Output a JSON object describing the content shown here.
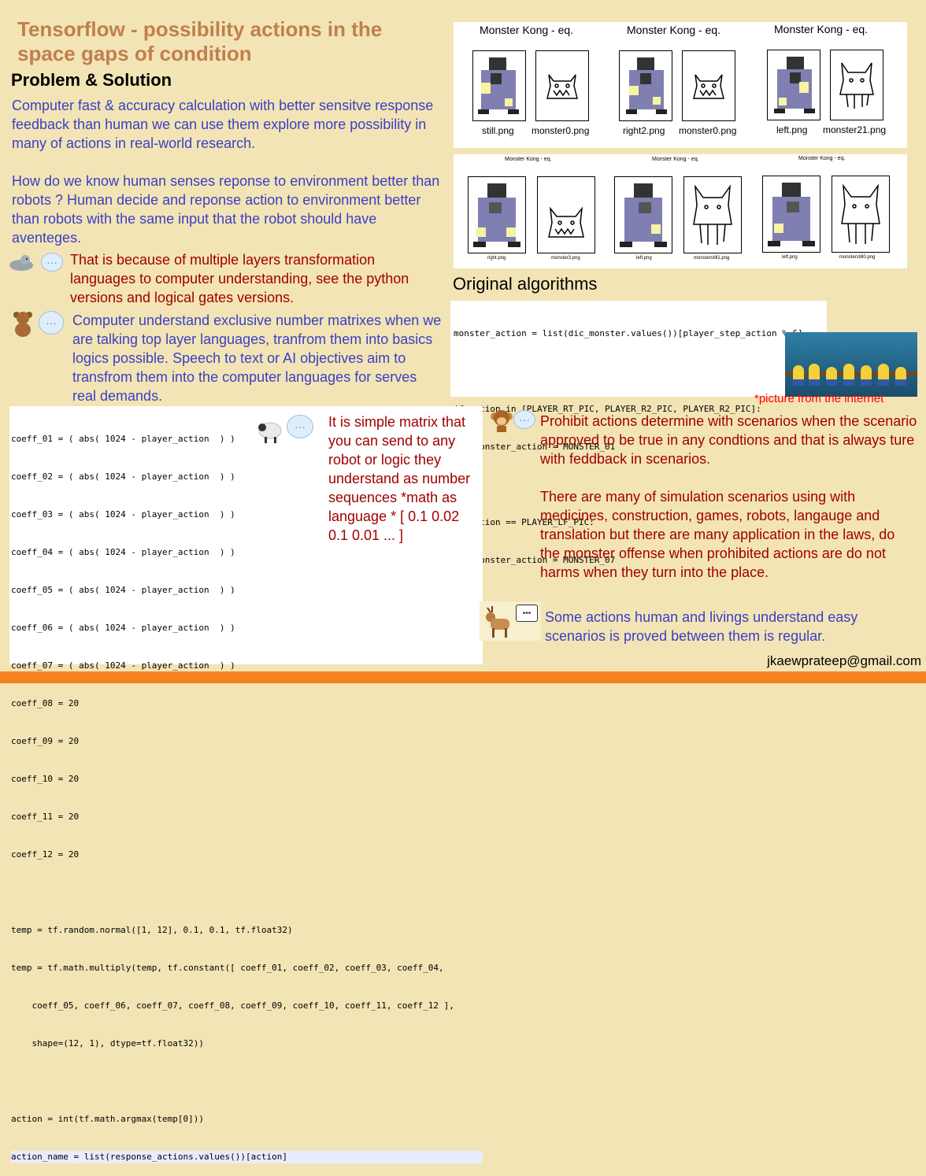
{
  "title": "Tensorflow - possibility actions in the space gaps of condition",
  "subtitle": "Problem & Solution",
  "paragraphs": {
    "p1": "Computer fast & accuracy calculation with better sensitve response feedback than human we can use them explore more possibility in many of actions in real-world research.",
    "p2": "How do we know human senses reponse to environment better than robots ? Human decide and reponse action to environment better than robots with the same input that the robot should have aventeges.",
    "p3": "That is because of multiple layers transformation languages to computer understanding, see the python versions and logical gates versions.",
    "p4": "Computer understand exclusive number matrixes when we are talking top layer languages, tranfrom them into basics logics possible. Speech to text or AI objectives aim to transfrom them into the computer languages for serves real demands.",
    "side": "It is simple matrix that you can send to any robot or logic they understand as number sequences *math as language * [ 0.1 0.02 0.1 0.01 ... ]",
    "p5": "Prohibit actions determine with scenarios when the scenario approved to be true in any condtions and that is always ture with feddback in scenarios.",
    "p6": "There are many of simulation scenarios using with medicines, construction, games, robots, langauge and translation but there are many application in the laws, do the monster offense when prohibited actions are do not harms when they turn into the place.",
    "p7": "Some actions human and livings understand easy scenarios is proved between them is regular."
  },
  "monster_panel_top": {
    "titles": [
      "Monster Kong - eq.",
      "Monster Kong - eq.",
      "Monster Kong - eq."
    ],
    "captions": [
      "still.png",
      "monster0.png",
      "right2.png",
      "monster0.png",
      "left.png",
      "monster21.png"
    ]
  },
  "monster_panel_bottom": {
    "titles": [
      "Monster Kong - eq.",
      "Monster Kong - eq.",
      "Monster Kong - eq."
    ],
    "captions": [
      "right.png",
      "monster3.png",
      "left.png",
      "monsterstill1.png",
      "left.png",
      "monsterstill0.png"
    ]
  },
  "algo_heading": "Original algorithms",
  "algo_code": [
    "monster_action = list(dic_monster.values())[player_step_action % 6]",
    "",
    "if action in [PLAYER_RT_PIC, PLAYER_R2_PIC, PLAYER_R2_PIC]:",
    "    monster_action = MONSTER_01",
    "",
    "if action == PLAYER_LF_PIC:",
    "    monster_action = MONSTER_07"
  ],
  "picture_note": "*picture from the internet",
  "coeff_lines": [
    "coeff_01 = ( abs( 1024 - player_action  ) )",
    "coeff_02 = ( abs( 1024 - player_action  ) )",
    "coeff_03 = ( abs( 1024 - player_action  ) )",
    "coeff_04 = ( abs( 1024 - player_action  ) )",
    "coeff_05 = ( abs( 1024 - player_action  ) )",
    "coeff_06 = ( abs( 1024 - player_action  ) )",
    "coeff_07 = ( abs( 1024 - player_action  ) )",
    "coeff_08 = 20",
    "coeff_09 = 20",
    "coeff_10 = 20",
    "coeff_11 = 20",
    "coeff_12 = 20",
    "",
    "temp = tf.random.normal([1, 12], 0.1, 0.1, tf.float32)",
    "temp = tf.math.multiply(temp, tf.constant([ coeff_01, coeff_02, coeff_03, coeff_04,",
    "    coeff_05, coeff_06, coeff_07, coeff_08, coeff_09, coeff_10, coeff_11, coeff_12 ],",
    "    shape=(12, 1), dtype=tf.float32))",
    "",
    "action = int(tf.math.argmax(temp[0]))",
    "action_name = list(response_actions.values())[action]"
  ],
  "email": "jkaewprateep@gmail.com",
  "icons": [
    "seal-icon",
    "chat-bubble-icon",
    "teddy-bear-icon",
    "chat-bubble-icon",
    "sheep-icon",
    "chat-bubble-icon",
    "monkey-icon",
    "chat-bubble-icon",
    "goat-icon",
    "speech-bubble-icon"
  ],
  "colors": {
    "background": "#f3e4b5",
    "title": "#c07f4e",
    "blue_text": "#3a40c4",
    "red_text": "#a00000",
    "footer": "#f58220"
  }
}
